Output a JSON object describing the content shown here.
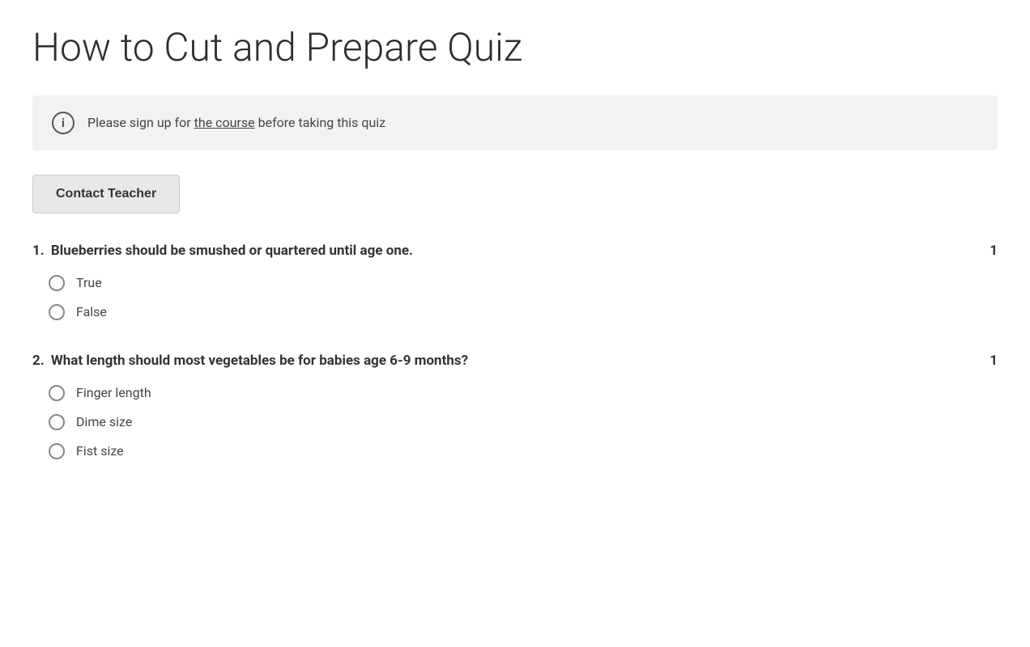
{
  "page": {
    "title": "How to Cut and Prepare Quiz",
    "info_banner": {
      "text_before_link": "Please sign up for ",
      "link_text": "the course",
      "text_after_link": " before taking this quiz"
    },
    "contact_button": "Contact Teacher",
    "questions": [
      {
        "number": "1",
        "text": "Blueberries should be smushed or quartered until age one.",
        "points": "1",
        "options": [
          "True",
          "False"
        ]
      },
      {
        "number": "2",
        "text": "What length should most vegetables be for babies age 6-9 months?",
        "points": "1",
        "options": [
          "Finger length",
          "Dime size",
          "Fist size"
        ]
      }
    ]
  }
}
